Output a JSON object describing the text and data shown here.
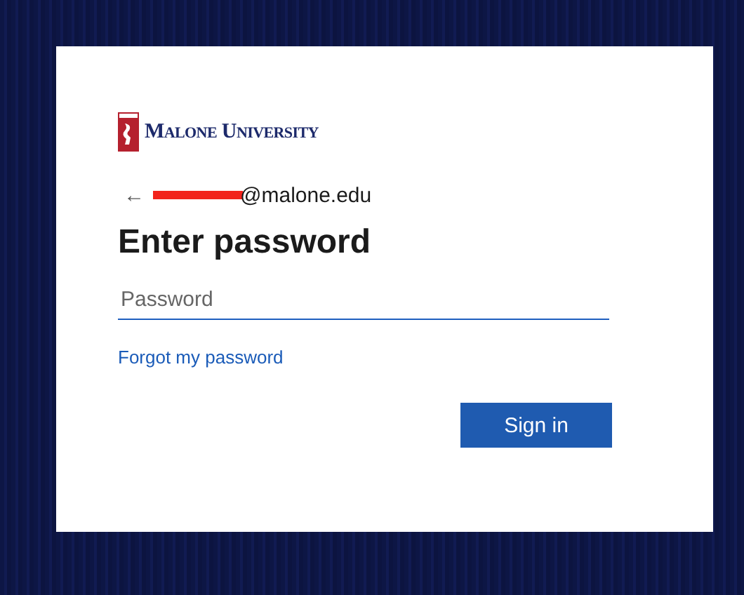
{
  "logo": {
    "text": "Malone University"
  },
  "identity": {
    "back": "←",
    "email": "@malone.edu",
    "redacted": true
  },
  "title": "Enter password",
  "password": {
    "placeholder": "Password"
  },
  "forgot_link": "Forgot my password",
  "buttons": [
    "Sign in"
  ]
}
